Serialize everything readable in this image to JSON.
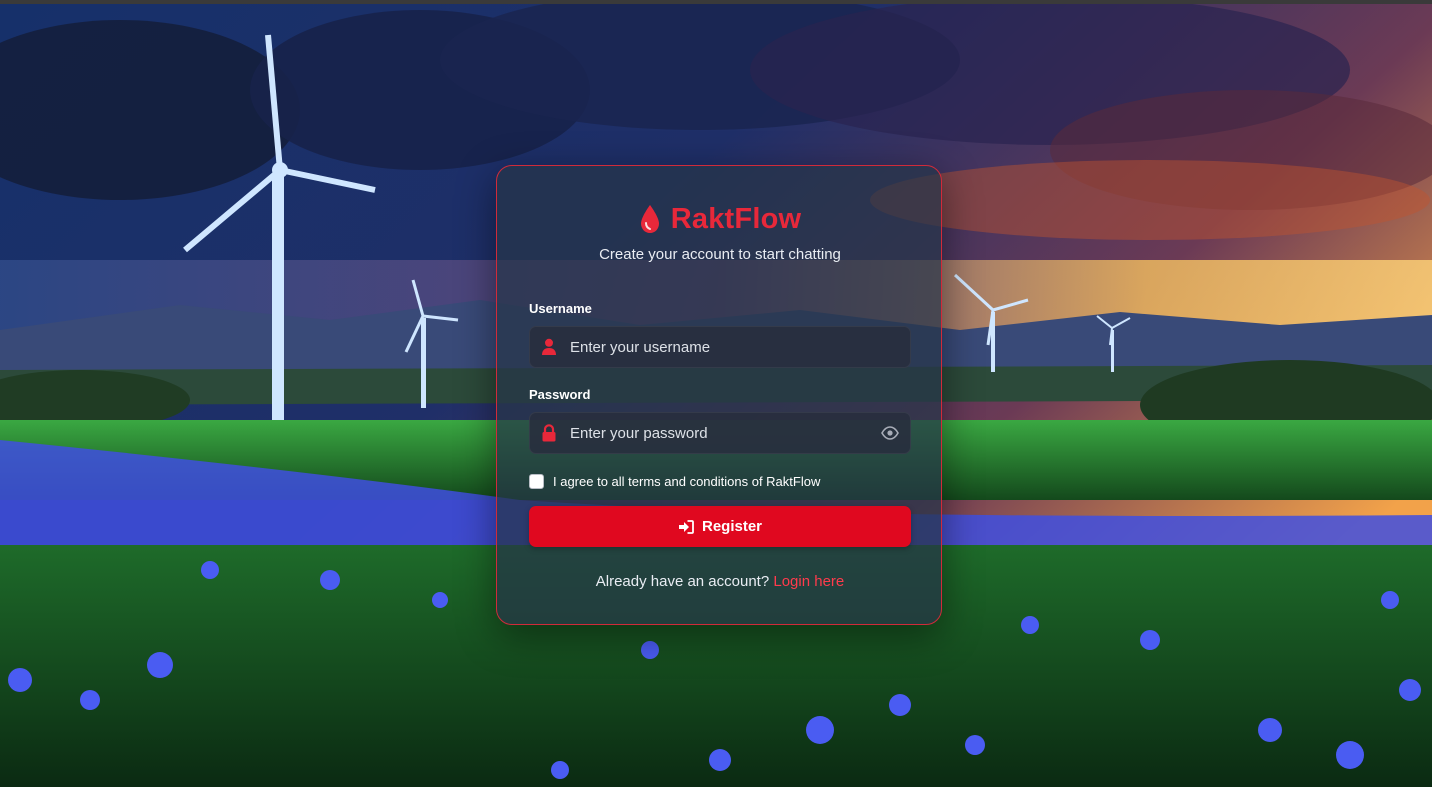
{
  "brand": {
    "name": "RaktFlow",
    "icon": "blood-drop-icon",
    "accent_color": "#e8283a"
  },
  "form": {
    "subtitle": "Create your account to start chatting",
    "username": {
      "label": "Username",
      "placeholder": "Enter your username",
      "value": "",
      "icon": "user-icon"
    },
    "password": {
      "label": "Password",
      "placeholder": "Enter your password",
      "value": "",
      "icon": "lock-icon",
      "toggle_icon": "eye-icon"
    },
    "terms": {
      "label": "I agree to all terms and conditions of RaktFlow",
      "checked": false
    },
    "submit": {
      "label": "Register",
      "icon": "sign-in-icon",
      "color": "#e0081f"
    },
    "footer": {
      "prompt": "Already have an account?",
      "link_label": "Login here"
    }
  },
  "background": {
    "description_colors": {
      "sky": "#1b2f63",
      "sunset": "#f08a3a",
      "field": "#2e8a34",
      "flowers": "#4a5cf2"
    }
  }
}
